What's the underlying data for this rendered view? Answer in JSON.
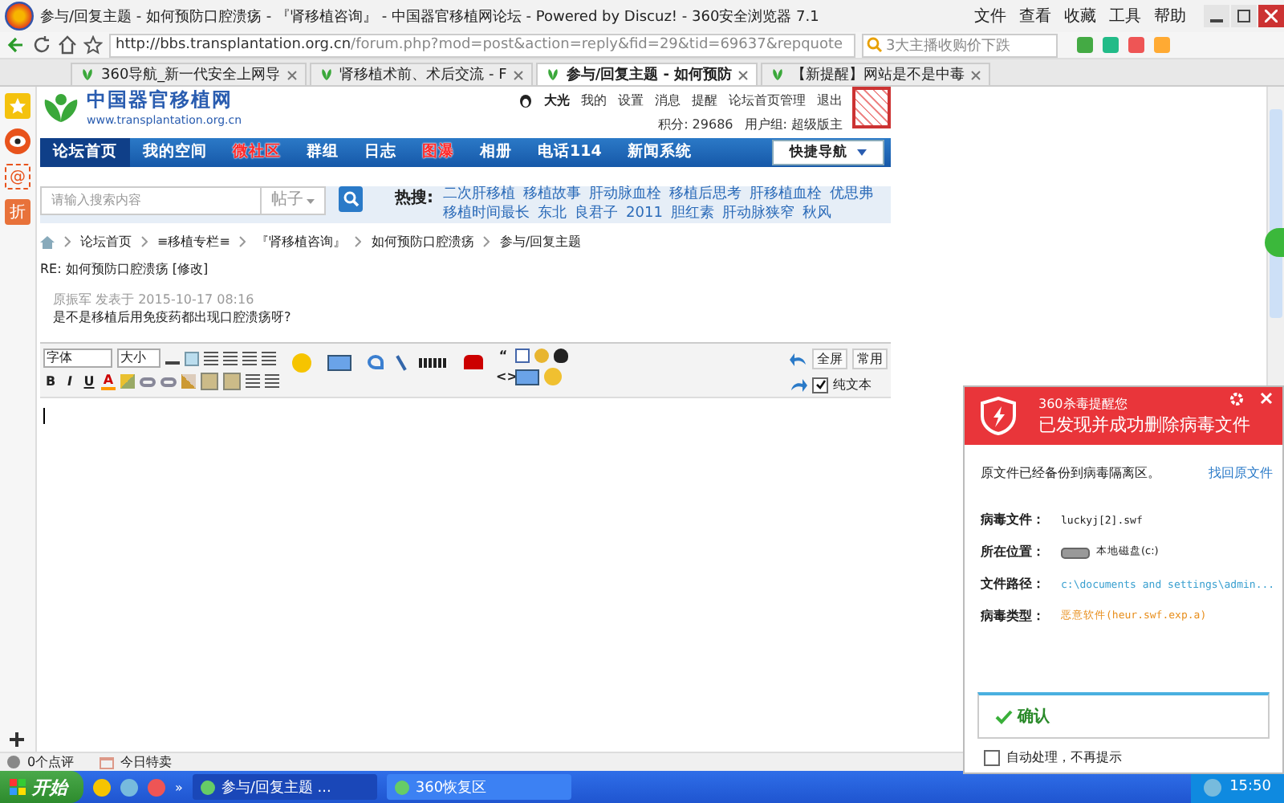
{
  "window": {
    "title": "参与/回复主题 - 如何预防口腔溃疡 - 『肾移植咨询』 - 中国器官移植网论坛 - Powered by Discuz! - 360安全浏览器 7.1",
    "menu": [
      "文件",
      "查看",
      "收藏",
      "工具",
      "帮助"
    ]
  },
  "address_bar": {
    "url_host": "http://bbs.transplantation.org.cn",
    "url_path": "/forum.php?mod=post&action=reply&fid=29&tid=69637&repquote",
    "search_placeholder": "3大主播收购价下跌"
  },
  "tabs": [
    {
      "label": "360导航_新一代安全上网导",
      "selected": false
    },
    {
      "label": "肾移植术前、术后交流 - F",
      "selected": false
    },
    {
      "label": "参与/回复主题 - 如何预防",
      "selected": true
    },
    {
      "label": "【新提醒】网站是不是中毒",
      "selected": false
    }
  ],
  "sidebar": {
    "items": [
      {
        "kind": "star"
      },
      {
        "kind": "eye"
      },
      {
        "kind": "glyph",
        "text": "@"
      },
      {
        "kind": "glyph",
        "text": "折"
      }
    ]
  },
  "site": {
    "logo_name": "中国器官移植网",
    "logo_url": "www.transplantation.org.cn",
    "user": "大光",
    "user_links": [
      "我的",
      "设置",
      "消息",
      "提醒",
      "论坛首页管理",
      "退出"
    ],
    "points": "积分: 29686",
    "group": "用户组: 超级版主"
  },
  "nav": {
    "items": [
      {
        "label": "论坛首页",
        "selected": true,
        "hot": false
      },
      {
        "label": "我的空间",
        "selected": false,
        "hot": false
      },
      {
        "label": "微社区",
        "selected": false,
        "hot": true
      },
      {
        "label": "群组",
        "selected": false,
        "hot": false
      },
      {
        "label": "日志",
        "selected": false,
        "hot": false
      },
      {
        "label": "图瀑",
        "selected": false,
        "hot": true
      },
      {
        "label": "相册",
        "selected": false,
        "hot": false
      },
      {
        "label": "电话114",
        "selected": false,
        "hot": false
      },
      {
        "label": "新闻系统",
        "selected": false,
        "hot": false
      }
    ],
    "quick": "快捷导航"
  },
  "search": {
    "placeholder": "请输入搜索内容",
    "scope": "帖子",
    "hot_label": "热搜:",
    "hot": [
      "二次肝移植",
      "移植故事",
      "肝动脉血栓",
      "移植后思考",
      "肝移植血栓",
      "优思弗",
      "移植时间最长",
      "东北",
      "良君子",
      "2011",
      "胆红素",
      "肝动脉狭窄",
      "秋风"
    ]
  },
  "breadcrumb": [
    "论坛首页",
    "≡移植专栏≡",
    "『肾移植咨询』",
    "如何预防口腔溃疡",
    "参与/回复主题"
  ],
  "post": {
    "subject": "RE: 如何预防口腔溃疡 [修改]",
    "quote_author": "原振军 发表于 2015-10-17 08:16",
    "quote_text": "是不是移植后用免疫药都出现口腔溃疡呀?"
  },
  "editor": {
    "font": "字体",
    "size": "大小",
    "format_letters": [
      "B",
      "I",
      "U",
      "A"
    ],
    "code_marks": [
      "“",
      "<>"
    ],
    "fullscreen": "全屏",
    "common": "常用",
    "plain_text": {
      "label": "纯文本",
      "checked": true
    }
  },
  "status_bar": {
    "reviews": "0个点评",
    "deals": "今日特卖"
  },
  "popup": {
    "brand": "360杀毒提醒您",
    "title": "已发现并成功删除病毒文件",
    "backup_note": "原文件已经备份到病毒隔离区。",
    "restore_link": "找回原文件",
    "fields": [
      {
        "label": "病毒文件：",
        "value": "luckyj[2].swf",
        "kind": "plain"
      },
      {
        "label": "所在位置：",
        "value": "本地磁盘(c:)",
        "kind": "disk"
      },
      {
        "label": "文件路径：",
        "value": "c:\\documents and settings\\admin...",
        "kind": "link"
      },
      {
        "label": "病毒类型：",
        "value": "恶意软件(heur.swf.exp.a)",
        "kind": "warning"
      }
    ],
    "confirm": "确认",
    "auto": {
      "label": "自动处理，不再提示",
      "checked": false
    }
  },
  "taskbar": {
    "start": "开始",
    "more": "»",
    "tasks": [
      {
        "label": "参与/回复主题 ...",
        "selected": true
      },
      {
        "label": "360恢复区",
        "selected": false
      }
    ],
    "clock": "15:50"
  }
}
